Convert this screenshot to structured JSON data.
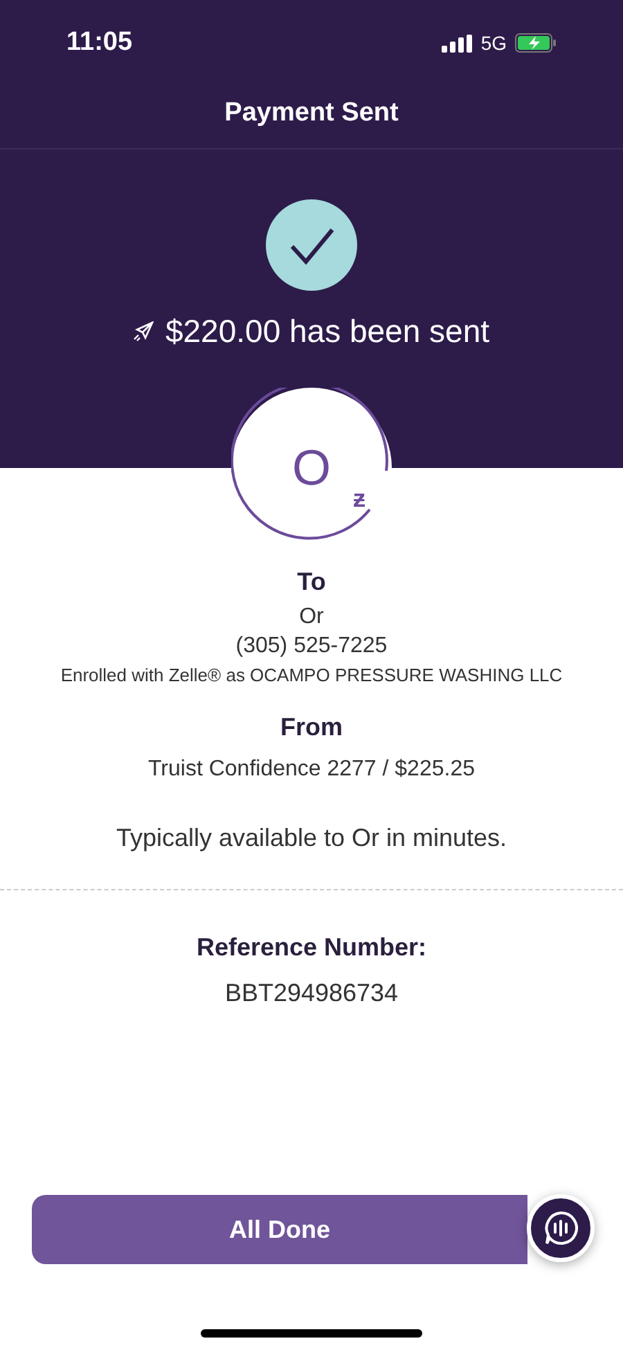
{
  "status_bar": {
    "time": "11:05",
    "network": "5G"
  },
  "header": {
    "title": "Payment Sent"
  },
  "confirmation": {
    "message": "$220.00 has been sent"
  },
  "recipient": {
    "initial": "O",
    "badge": "ƶ"
  },
  "to": {
    "heading": "To",
    "name": "Or",
    "phone": "(305) 525-7225",
    "enrolled": "Enrolled with Zelle® as OCAMPO PRESSURE WASHING LLC"
  },
  "from": {
    "heading": "From",
    "account": "Truist Confidence 2277 / $225.25"
  },
  "availability": "Typically available to Or in minutes.",
  "reference": {
    "heading": "Reference Number:",
    "number": "BBT294986734"
  },
  "buttons": [
    {
      "label": "All Done",
      "kind": "primary"
    }
  ]
}
